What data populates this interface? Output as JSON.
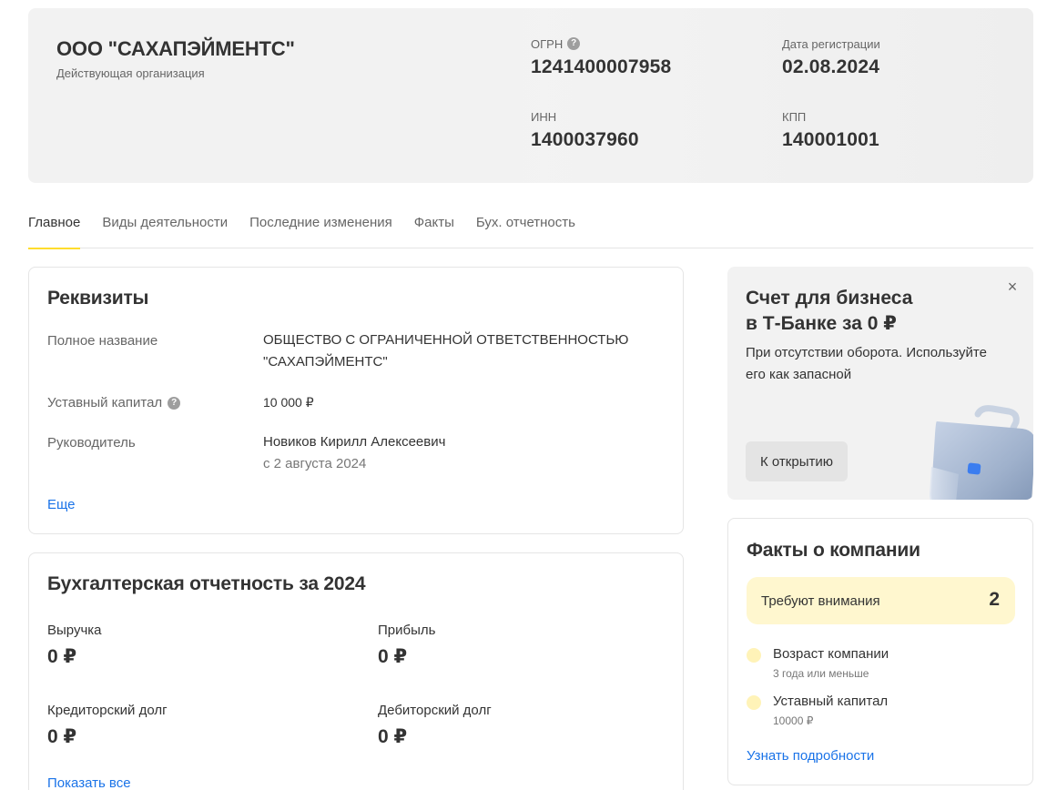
{
  "header": {
    "company_name": "ООО \"САХАПЭЙМЕНТС\"",
    "status": "Действующая организация",
    "ogrn_label": "ОГРН",
    "ogrn_value": "1241400007958",
    "reg_date_label": "Дата регистрации",
    "reg_date_value": "02.08.2024",
    "inn_label": "ИНН",
    "inn_value": "1400037960",
    "kpp_label": "КПП",
    "kpp_value": "140001001",
    "help_glyph": "?"
  },
  "tabs": [
    {
      "label": "Главное",
      "active": true
    },
    {
      "label": "Виды деятельности",
      "active": false
    },
    {
      "label": "Последние изменения",
      "active": false
    },
    {
      "label": "Факты",
      "active": false
    },
    {
      "label": "Бух. отчетность",
      "active": false
    }
  ],
  "requisites": {
    "title": "Реквизиты",
    "full_name_label": "Полное название",
    "full_name_line1": "ОБЩЕСТВО С ОГРАНИЧЕННОЙ ОТВЕТСТВЕННОСТЬЮ",
    "full_name_line2": "\"САХАПЭЙМЕНТС\"",
    "capital_label": "Уставный капитал",
    "capital_value": "10 000 ₽",
    "head_label": "Руководитель",
    "head_value": "Новиков Кирилл Алексеевич",
    "head_since": "с 2 августа 2024",
    "more_link": "Еще"
  },
  "accounting": {
    "title": "Бухгалтерская отчетность за 2024",
    "revenue_label": "Выручка",
    "revenue_value": "0 ₽",
    "profit_label": "Прибыль",
    "profit_value": "0 ₽",
    "payables_label": "Кредиторский долг",
    "payables_value": "0 ₽",
    "receivables_label": "Дебиторский долг",
    "receivables_value": "0 ₽",
    "show_all_link": "Показать все"
  },
  "promo": {
    "title_line1": "Счет для бизнеса",
    "title_line2": "в Т-Банке за 0 ₽",
    "text_line1": "При отсутствии оборота. Используйте",
    "text_line2": "его как запасной",
    "button_label": "К открытию",
    "close_glyph": "×",
    "image_icon": "briefcase-icon"
  },
  "facts": {
    "title": "Факты о компании",
    "attention_label": "Требуют внимания",
    "attention_count": "2",
    "items": [
      {
        "name": "Возраст компании",
        "sub": "3 года или меньше"
      },
      {
        "name": "Уставный капитал",
        "sub": "10000 ₽"
      }
    ],
    "details_link": "Узнать подробности"
  },
  "colors": {
    "accent_yellow": "#ffdd2d",
    "link_blue": "#1a73e8",
    "attention_bg": "#fff7cf",
    "fact_dot": "#fff3b8",
    "header_bg": "#f2f2f2"
  }
}
